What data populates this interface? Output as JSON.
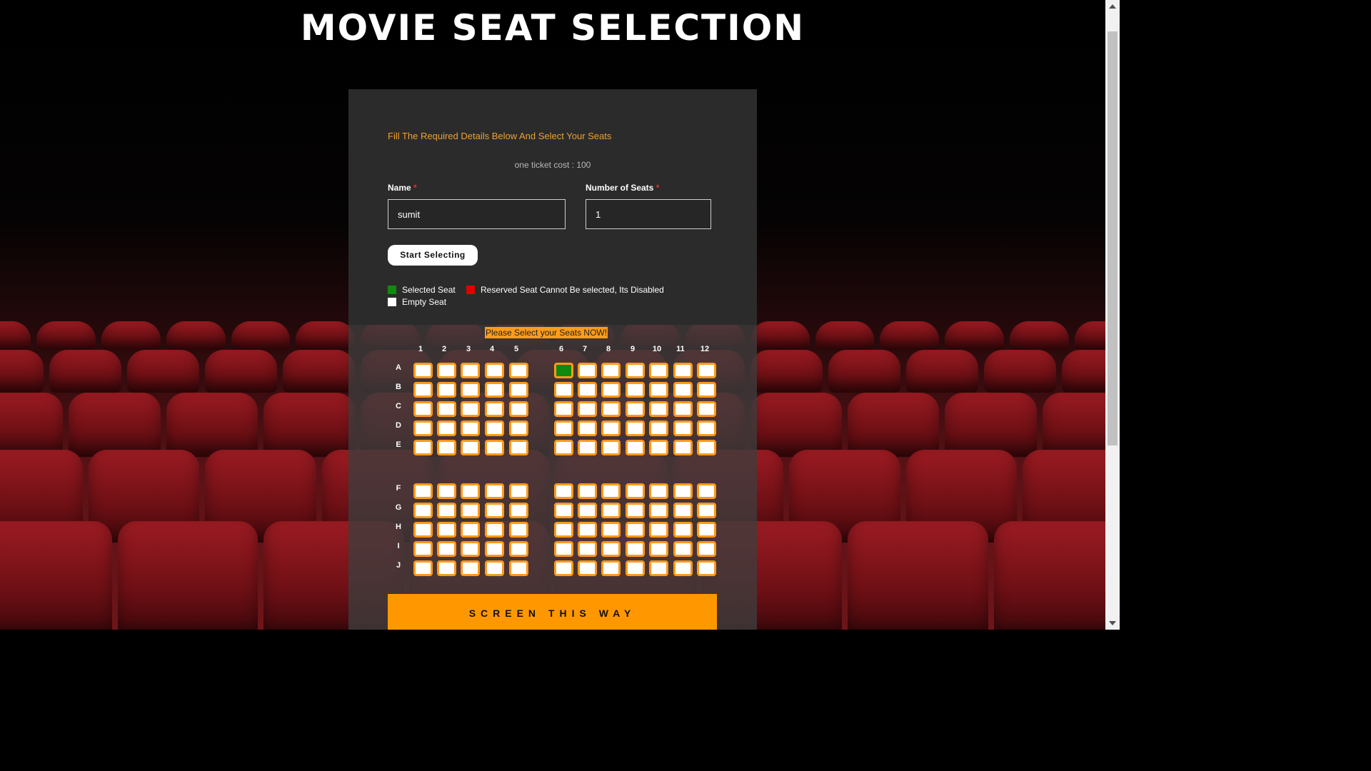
{
  "page": {
    "title": "MOVIE SEAT SELECTION"
  },
  "form": {
    "instruction": "Fill The Required Details Below And Select Your Seats",
    "ticket_cost": "one ticket cost : 100",
    "name_label": "Name",
    "name_value": "sumit",
    "seats_label": "Number of Seats",
    "seats_value": "1",
    "required_mark": "*",
    "start_button": "Start Selecting"
  },
  "legend": {
    "selected": "Selected Seat",
    "reserved": "Reserved Seat Cannot Be selected, Its Disabled",
    "empty": "Empty Seat",
    "colors": {
      "selected": "#0f8a0f",
      "reserved": "#e00000",
      "empty": "#ffffff"
    }
  },
  "seat_map": {
    "prompt": "Please Select your Seats NOW!",
    "columns": [
      "1",
      "2",
      "3",
      "4",
      "5",
      "6",
      "7",
      "8",
      "9",
      "10",
      "11",
      "12"
    ],
    "rows": [
      "A",
      "B",
      "C",
      "D",
      "E",
      "F",
      "G",
      "H",
      "I",
      "J"
    ],
    "selected_seats": [
      "A6"
    ],
    "reserved_seats": []
  },
  "screen": {
    "label": "SCREEN THIS WAY"
  },
  "colors": {
    "accent": "#ff9800",
    "seat_border": "#ff9a1a",
    "panel": "#2b2b2b"
  }
}
